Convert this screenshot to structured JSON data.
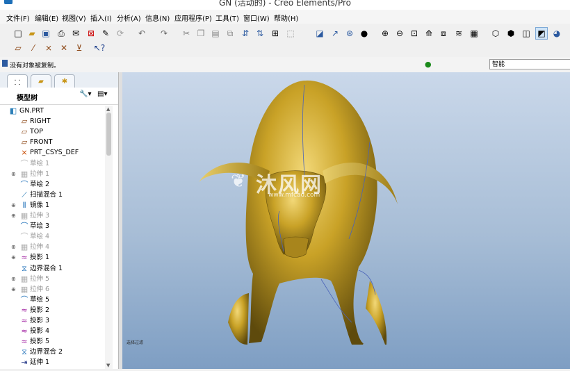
{
  "window": {
    "title": "GN (活动的) - Creo Elements/Pro"
  },
  "menu": [
    "文件(F)",
    "编辑(E)",
    "视图(V)",
    "插入(I)",
    "分析(A)",
    "信息(N)",
    "应用程序(P)",
    "工具(T)",
    "窗口(W)",
    "帮助(H)"
  ],
  "status": {
    "message": "没有对象被复制。",
    "filter_value": "智能"
  },
  "model_tree": {
    "title": "模型树",
    "settings_label": "▾",
    "show_label": "▾",
    "items": [
      {
        "label": "GN.PRT",
        "icon": "part-icon",
        "dim": false,
        "expand": ""
      },
      {
        "label": "RIGHT",
        "icon": "datum-plane-icon",
        "dim": false,
        "expand": ""
      },
      {
        "label": "TOP",
        "icon": "datum-plane-icon",
        "dim": false,
        "expand": ""
      },
      {
        "label": "FRONT",
        "icon": "datum-plane-icon",
        "dim": false,
        "expand": ""
      },
      {
        "label": "PRT_CSYS_DEF",
        "icon": "csys-icon",
        "dim": false,
        "expand": ""
      },
      {
        "label": "草绘 1",
        "icon": "sketch-icon",
        "dim": true,
        "expand": ""
      },
      {
        "label": "拉伸 1",
        "icon": "extrude-icon",
        "dim": true,
        "expand": "+"
      },
      {
        "label": "草绘 2",
        "icon": "sketch-icon",
        "dim": false,
        "expand": ""
      },
      {
        "label": "扫描混合 1",
        "icon": "swept-blend-icon",
        "dim": false,
        "expand": ""
      },
      {
        "label": "镜像 1",
        "icon": "mirror-icon",
        "dim": false,
        "expand": "+"
      },
      {
        "label": "拉伸 3",
        "icon": "extrude-icon",
        "dim": true,
        "expand": "+"
      },
      {
        "label": "草绘 3",
        "icon": "sketch-icon",
        "dim": false,
        "expand": ""
      },
      {
        "label": "草绘 4",
        "icon": "sketch-icon",
        "dim": true,
        "expand": ""
      },
      {
        "label": "拉伸 4",
        "icon": "extrude-icon",
        "dim": true,
        "expand": "+"
      },
      {
        "label": "投影 1",
        "icon": "projection-icon",
        "dim": false,
        "expand": "+"
      },
      {
        "label": "边界混合 1",
        "icon": "boundary-blend-icon",
        "dim": false,
        "expand": ""
      },
      {
        "label": "拉伸 5",
        "icon": "extrude-icon",
        "dim": true,
        "expand": "+"
      },
      {
        "label": "拉伸 6",
        "icon": "extrude-icon",
        "dim": true,
        "expand": "+"
      },
      {
        "label": "草绘 5",
        "icon": "sketch-icon",
        "dim": false,
        "expand": ""
      },
      {
        "label": "投影 2",
        "icon": "projection-icon",
        "dim": false,
        "expand": ""
      },
      {
        "label": "投影 3",
        "icon": "projection-icon",
        "dim": false,
        "expand": ""
      },
      {
        "label": "投影 4",
        "icon": "projection-icon",
        "dim": false,
        "expand": ""
      },
      {
        "label": "投影 5",
        "icon": "projection-icon",
        "dim": false,
        "expand": ""
      },
      {
        "label": "边界混合 2",
        "icon": "boundary-blend-icon",
        "dim": false,
        "expand": ""
      },
      {
        "label": "延伸 1",
        "icon": "extend-icon",
        "dim": false,
        "expand": ""
      }
    ]
  },
  "viewport": {
    "watermark_cn": "沐风网",
    "watermark_en": "www.mfcad.com",
    "corner_label": "选择过滤",
    "model_color": "#c9a227",
    "background_top": "#cad8ea",
    "background_bottom": "#7e9ec3"
  },
  "icons": {
    "toolbar_row1": [
      "new-icon",
      "open-icon",
      "save-icon",
      "print-icon",
      "send-icon",
      "close-window-icon",
      "edit-icon",
      "regenerate-icon",
      "undo-icon",
      "redo-icon",
      "cut-icon",
      "copy-icon",
      "paste-icon",
      "find-icon",
      "select-icon",
      "binoculars-icon",
      "box-select-icon",
      "datum-display-icon",
      "axis-icon",
      "csys-display-icon",
      "spin-center-icon",
      "zoom-in-icon",
      "zoom-out-icon",
      "refit-icon",
      "reorient-icon",
      "saved-views-icon",
      "layers-icon",
      "appearance-icon",
      "wireframe-icon",
      "hidden-line-icon",
      "no-hidden-icon",
      "shading-icon",
      "model-tree-icon"
    ],
    "toolbar_row2": [
      "sketch-plane-icon",
      "sketch-pencil-icon",
      "datum-point-icon",
      "datum-axis-icon",
      "analysis-icon",
      "whats-this-icon"
    ]
  }
}
